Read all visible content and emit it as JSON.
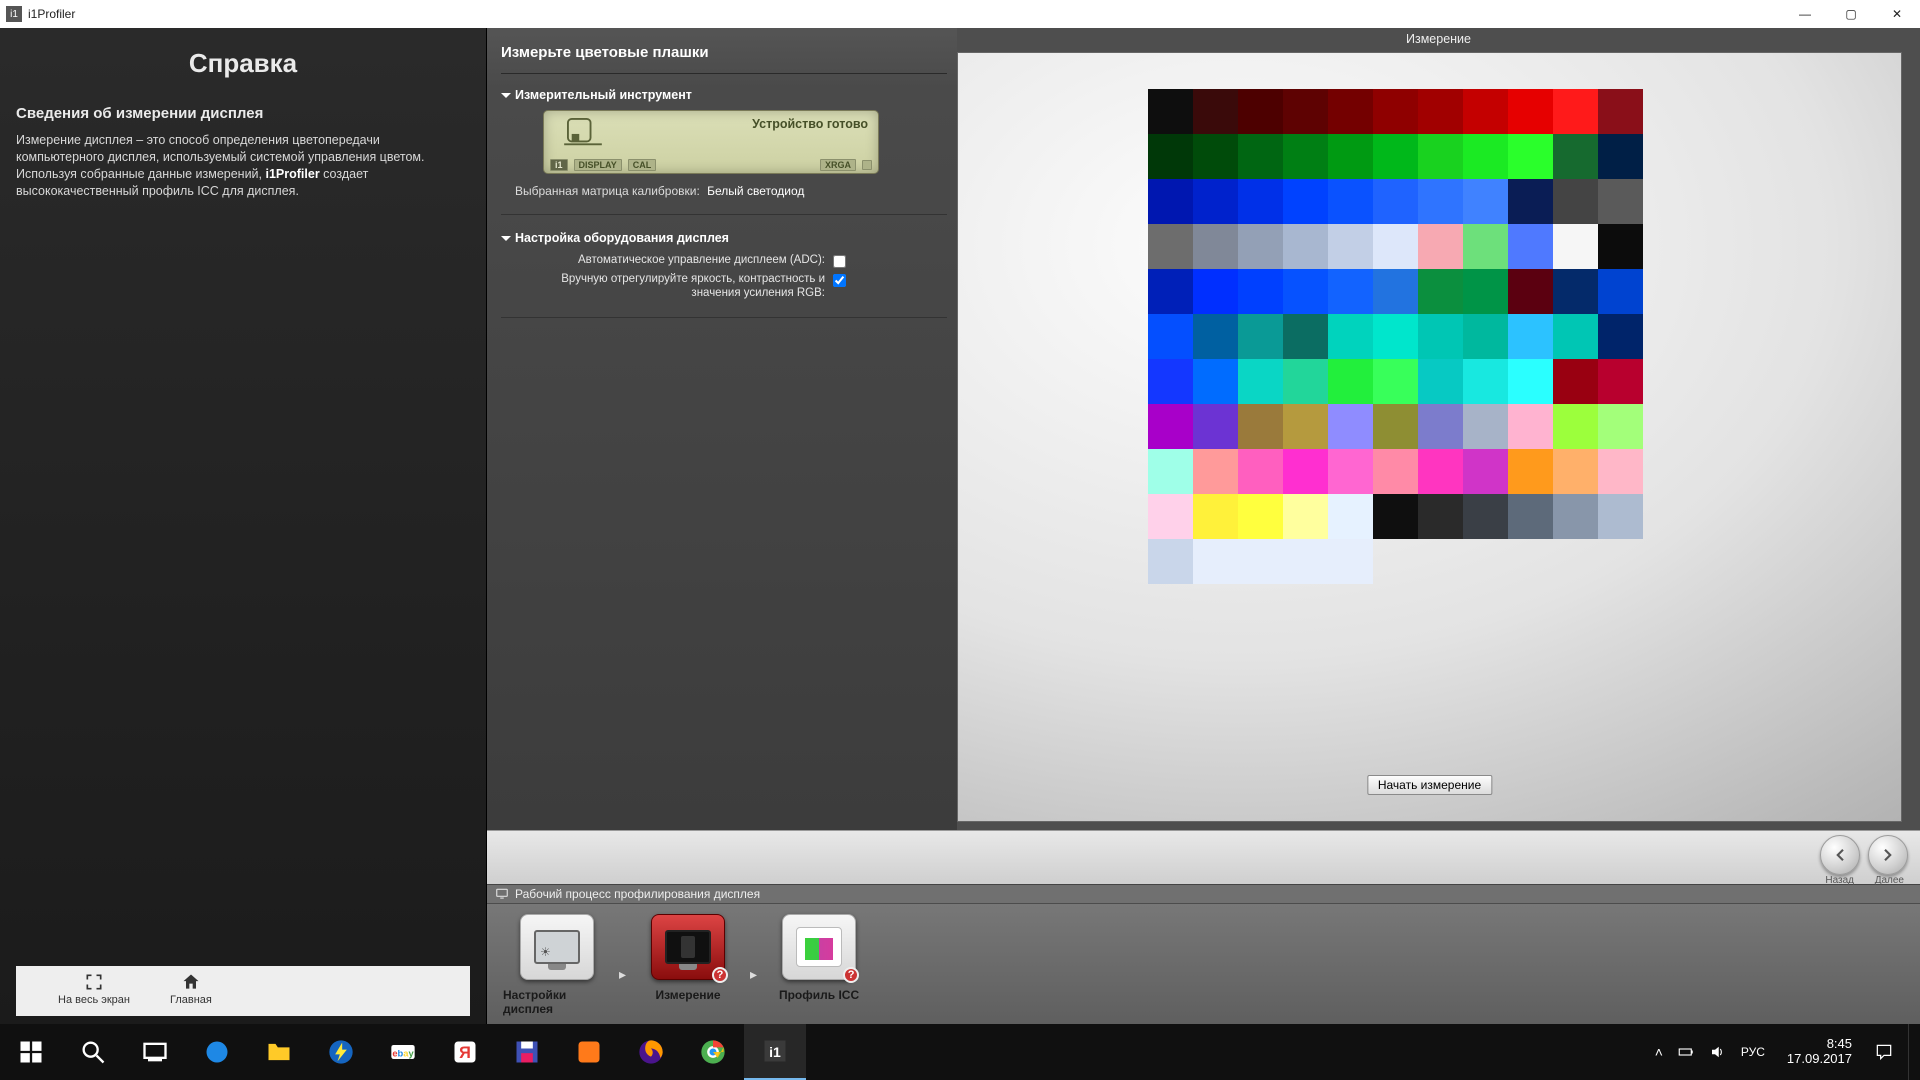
{
  "window": {
    "title": "i1Profiler",
    "min": "—",
    "max": "▢",
    "close": "✕"
  },
  "help": {
    "title": "Справка",
    "heading": "Сведения об измерении дисплея",
    "body_pre": "Измерение дисплея – это способ определения цветопередачи компьютерного дисплея, используемый системой управления цветом. Используя собранные данные измерений, ",
    "body_bold": "i1Profiler",
    "body_post": " создает высококачественный профиль ICC для дисплея.",
    "foot_fullscreen": "На весь экран",
    "foot_home": "Главная"
  },
  "settings": {
    "page_title": "Измерьте цветовые плашки",
    "sec_instrument": "Измерительный инструмент",
    "device_status": "Устройство готово",
    "chips": {
      "i1": "i1",
      "display": "DISPLAY",
      "cal": "CAL",
      "xrga": "XRGA"
    },
    "matrix_label": "Выбранная матрица калибровки:",
    "matrix_value": "Белый светодиод",
    "sec_hardware": "Настройка оборудования дисплея",
    "opt_adc": "Автоматическое управление дисплеем (ADC):",
    "opt_manual": "Вручную отрегулируйте яркость, контрастность и значения усиления RGB:"
  },
  "preview": {
    "title": "Измерение",
    "start": "Начать измерение",
    "swatches": [
      "#0e0e0e",
      "#3a0a0a",
      "#4d0000",
      "#5e0202",
      "#740000",
      "#8f0000",
      "#a10000",
      "#c40000",
      "#e60000",
      "#ff1a1a",
      "#8a0f19",
      "#003808",
      "#004b0a",
      "#006612",
      "#007f14",
      "#009a12",
      "#00b81a",
      "#19d21f",
      "#1bea23",
      "#2aff2b",
      "#166a2f",
      "#001f46",
      "#0017b0",
      "#0022cc",
      "#0030e8",
      "#0042ff",
      "#0a52ff",
      "#1f63ff",
      "#2f74ff",
      "#4082ff",
      "#0a1d55",
      "#444444",
      "#5a5a5a",
      "#6d6d6d",
      "#808898",
      "#93a0b6",
      "#a8b7d0",
      "#c2cfe6",
      "#dde7fa",
      "#f7a9b2",
      "#6de07b",
      "#4f79ff",
      "#f6f6f6",
      "#0c0c0c",
      "#0020b8",
      "#002fff",
      "#0040ff",
      "#0652ff",
      "#1263ff",
      "#2273e0",
      "#0b8f3e",
      "#009447",
      "#5b0010",
      "#042a6a",
      "#0043d0",
      "#044fff",
      "#0060a1",
      "#0a9a96",
      "#0b6d62",
      "#00d3bd",
      "#00e6cc",
      "#00c6b4",
      "#00b89e",
      "#2cc2ff",
      "#00c6b4",
      "#00246a",
      "#1437ff",
      "#006cff",
      "#0ad6c5",
      "#22d69a",
      "#22ef3c",
      "#38ff5a",
      "#07c9c3",
      "#18e8e0",
      "#2affff",
      "#990011",
      "#b8002e",
      "#a800c9",
      "#6c33d3",
      "#9a7a3b",
      "#b59a3e",
      "#8f8cff",
      "#8e8e33",
      "#7c7ccc",
      "#a7b3c8",
      "#ffb3d0",
      "#9cff3c",
      "#a3ff7a",
      "#9fffe8",
      "#ff9a9a",
      "#ff5fbf",
      "#ff2fd0",
      "#ff66d1",
      "#ff8aa7",
      "#ff35c0",
      "#d034c8",
      "#ff9a1c",
      "#ffb06a",
      "#ffb7c8",
      "#ffd1ea",
      "#fff13a",
      "#ffff3e",
      "#ffff9e",
      "#e6f2ff",
      "#0f0f0f",
      "#2a2a2a",
      "#3a3f46",
      "#5d6a7a",
      "#8896aa",
      "#adbbd0",
      "#c9d6ea",
      "#e6eefc",
      "#e6eefc",
      "#e6eefc",
      "#e6eefc"
    ]
  },
  "nav": {
    "back": "Назад",
    "next": "Далее"
  },
  "workflow": {
    "header": "Рабочий процесс профилирования дисплея",
    "items": [
      {
        "label": "Настройки дисплея"
      },
      {
        "label": "Измерение"
      },
      {
        "label": "Профиль ICC"
      }
    ]
  },
  "taskbar": {
    "lang": "РУС",
    "time": "8:45",
    "date": "17.09.2017"
  }
}
